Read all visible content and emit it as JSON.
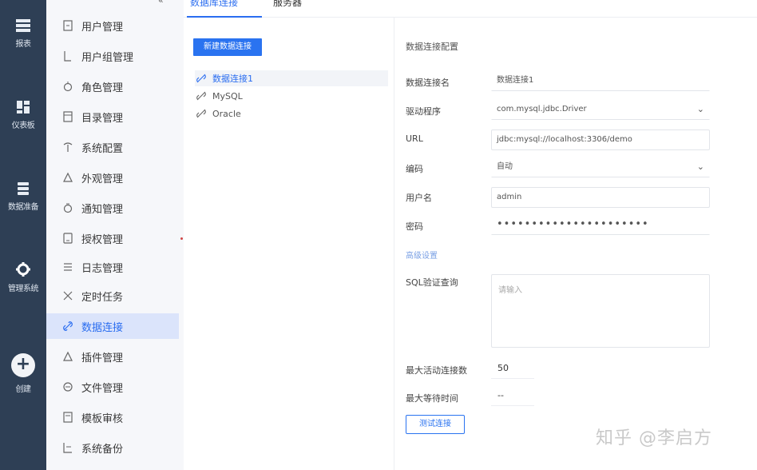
{
  "rail": {
    "items": [
      {
        "icon": "list-icon",
        "label": "报表"
      },
      {
        "icon": "dashboard-icon",
        "label": "仪表板"
      },
      {
        "icon": "database-icon",
        "label": "数据准备"
      },
      {
        "icon": "gear-icon",
        "label": "管理系统"
      },
      {
        "icon": "plus-icon",
        "label": "创建"
      }
    ]
  },
  "nav": {
    "items": [
      {
        "label": "用户管理"
      },
      {
        "label": "用户组管理"
      },
      {
        "label": "角色管理"
      },
      {
        "label": "目录管理"
      },
      {
        "label": "系统配置"
      },
      {
        "label": "外观管理"
      },
      {
        "label": "通知管理"
      },
      {
        "label": "授权管理"
      },
      {
        "label": "日志管理"
      },
      {
        "label": "定时任务"
      },
      {
        "label": "数据连接"
      },
      {
        "label": "插件管理"
      },
      {
        "label": "文件管理"
      },
      {
        "label": "模板审核"
      },
      {
        "label": "系统备份"
      }
    ],
    "active_index": 10
  },
  "tabs": [
    {
      "label": "数据库连接"
    },
    {
      "label": "服务器"
    }
  ],
  "connections": {
    "new_button": "新建数据连接",
    "items": [
      {
        "label": "数据连接1"
      },
      {
        "label": "MySQL"
      },
      {
        "label": "Oracle"
      }
    ],
    "active_index": 0
  },
  "form": {
    "title": "数据连接配置",
    "fields": {
      "name": {
        "label": "数据连接名",
        "value": "数据连接1"
      },
      "driver": {
        "label": "驱动程序",
        "value": "com.mysql.jdbc.Driver"
      },
      "url": {
        "label": "URL",
        "value": "jdbc:mysql://localhost:3306/demo"
      },
      "encoding": {
        "label": "编码",
        "value": "自动"
      },
      "username": {
        "label": "用户名",
        "value": "admin"
      },
      "password": {
        "label": "密码",
        "value": "••••••••••••••••••••••"
      },
      "advanced": {
        "label": "高级设置"
      },
      "sql": {
        "label": "SQL验证查询",
        "placeholder": "请输入"
      },
      "max_active": {
        "label": "最大活动连接数",
        "value": "50"
      },
      "max_wait": {
        "label": "最大等待时间",
        "value": "--"
      }
    },
    "test_button": "测试连接"
  },
  "watermark": "知乎 @李启方"
}
